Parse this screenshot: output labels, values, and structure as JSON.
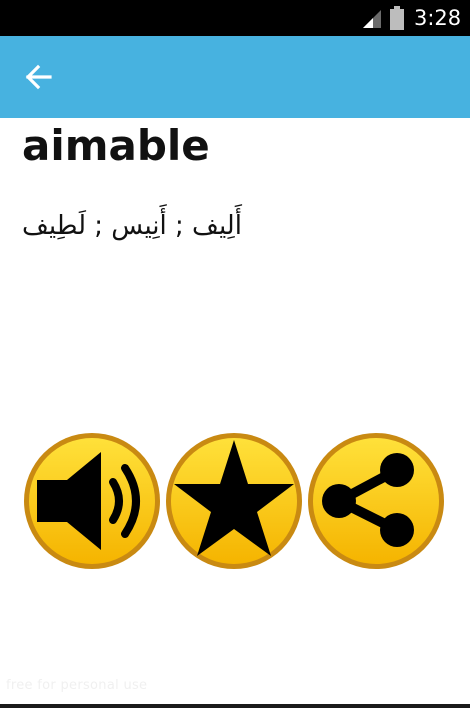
{
  "status_bar": {
    "time": "3:28",
    "icons": [
      "signal-icon",
      "battery-icon"
    ]
  },
  "app_bar": {
    "back_icon": "arrow-left-icon",
    "color": "#47b2e0"
  },
  "entry": {
    "word": "aimable",
    "translation": "أَلِيف ; أَنِيس ; لَطِيف"
  },
  "actions": [
    {
      "name": "sound",
      "icon": "speaker-icon"
    },
    {
      "name": "favorite",
      "icon": "star-icon"
    },
    {
      "name": "share",
      "icon": "share-icon"
    }
  ],
  "button_colors": {
    "ring": "#c98a12",
    "fill_top": "#ffe13a",
    "fill_bottom": "#f5b400",
    "glyph": "#000000"
  },
  "watermark": "free for personal use"
}
